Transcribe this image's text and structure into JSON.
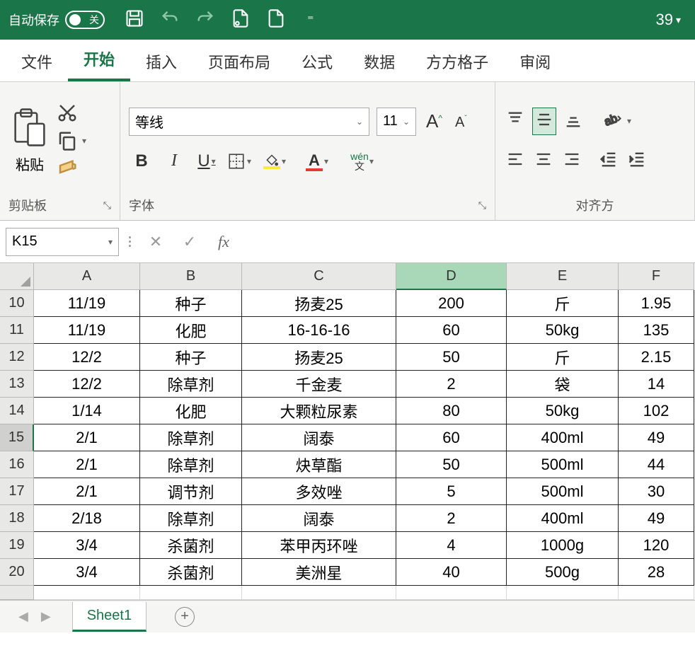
{
  "titlebar": {
    "autosave_label": "自动保存",
    "autosave_state": "关",
    "zoom_display": "39"
  },
  "tabs": {
    "items": [
      "文件",
      "开始",
      "插入",
      "页面布局",
      "公式",
      "数据",
      "方方格子",
      "审阅"
    ],
    "active_index": 1
  },
  "ribbon": {
    "clipboard": {
      "paste_label": "粘贴",
      "group_label": "剪贴板"
    },
    "font": {
      "name": "等线",
      "size": "11",
      "bold": "B",
      "italic": "I",
      "underline": "U",
      "wen_top": "wén",
      "wen_bottom": "文",
      "group_label": "字体",
      "increase_label": "A",
      "decrease_label": "A"
    },
    "align": {
      "group_label": "对齐方"
    }
  },
  "formula_bar": {
    "name_box": "K15",
    "fx": "fx",
    "value": ""
  },
  "grid": {
    "columns": [
      "A",
      "B",
      "C",
      "D",
      "E",
      "F"
    ],
    "selected_col": "D",
    "selected_row": "15",
    "rows": [
      {
        "num": "10",
        "cells": [
          "11/19",
          "种子",
          "扬麦25",
          "200",
          "斤",
          "1.95"
        ]
      },
      {
        "num": "11",
        "cells": [
          "11/19",
          "化肥",
          "16-16-16",
          "60",
          "50kg",
          "135"
        ]
      },
      {
        "num": "12",
        "cells": [
          "12/2",
          "种子",
          "扬麦25",
          "50",
          "斤",
          "2.15"
        ]
      },
      {
        "num": "13",
        "cells": [
          "12/2",
          "除草剂",
          "千金麦",
          "2",
          "袋",
          "14"
        ]
      },
      {
        "num": "14",
        "cells": [
          "1/14",
          "化肥",
          "大颗粒尿素",
          "80",
          "50kg",
          "102"
        ]
      },
      {
        "num": "15",
        "cells": [
          "2/1",
          "除草剂",
          "阔泰",
          "60",
          "400ml",
          "49"
        ]
      },
      {
        "num": "16",
        "cells": [
          "2/1",
          "除草剂",
          "炔草酯",
          "50",
          "500ml",
          "44"
        ]
      },
      {
        "num": "17",
        "cells": [
          "2/1",
          "调节剂",
          "多效唑",
          "5",
          "500ml",
          "30"
        ]
      },
      {
        "num": "18",
        "cells": [
          "2/18",
          "除草剂",
          "阔泰",
          "2",
          "400ml",
          "49"
        ]
      },
      {
        "num": "19",
        "cells": [
          "3/4",
          "杀菌剂",
          "苯甲丙环唑",
          "4",
          "1000g",
          "120"
        ]
      },
      {
        "num": "20",
        "cells": [
          "3/4",
          "杀菌剂",
          "美洲星",
          "40",
          "500g",
          "28"
        ]
      }
    ]
  },
  "sheet_tabs": {
    "active": "Sheet1"
  }
}
